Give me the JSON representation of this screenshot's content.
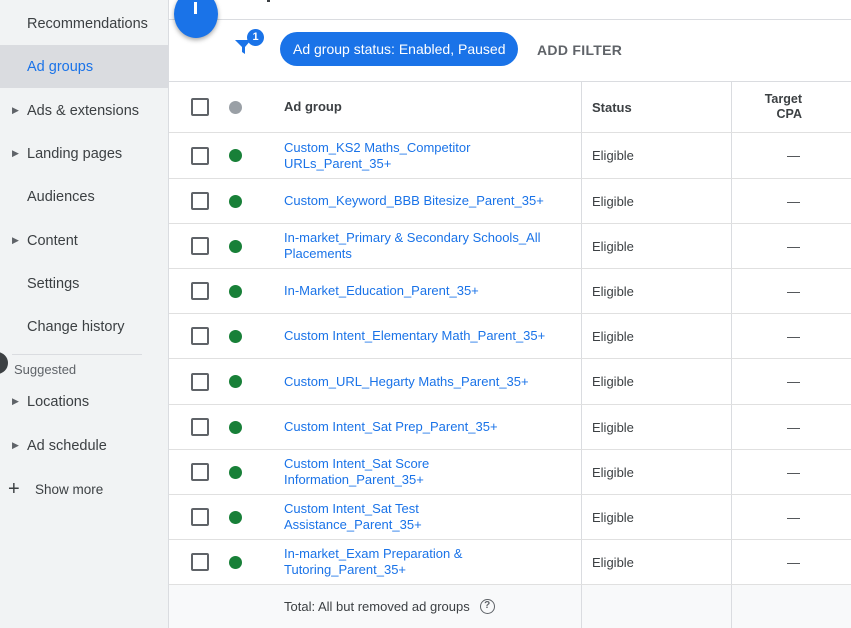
{
  "sidebar": {
    "items": [
      {
        "label": "Recommendations",
        "has_caret": false,
        "active": false
      },
      {
        "label": "Ad groups",
        "has_caret": false,
        "active": true
      },
      {
        "label": "Ads & extensions",
        "has_caret": true,
        "active": false
      },
      {
        "label": "Landing pages",
        "has_caret": true,
        "active": false
      },
      {
        "label": "Audiences",
        "has_caret": false,
        "active": false
      },
      {
        "label": "Content",
        "has_caret": true,
        "active": false
      },
      {
        "label": "Settings",
        "has_caret": false,
        "active": false
      },
      {
        "label": "Change history",
        "has_caret": false,
        "active": false
      }
    ],
    "suggested_label": "Suggested",
    "suggested_items": [
      {
        "label": "Locations",
        "has_caret": true
      },
      {
        "label": "Ad schedule",
        "has_caret": true
      }
    ],
    "show_more_label": "Show more",
    "show_more_icon": "+"
  },
  "filter_bar": {
    "filter_count": "1",
    "chip_label": "Ad group status: Enabled, Paused",
    "add_filter_label": "ADD FILTER"
  },
  "table": {
    "columns": {
      "ad_group": "Ad group",
      "status": "Status",
      "target_cpa_line1": "Target",
      "target_cpa_line2": "CPA"
    },
    "rows": [
      {
        "name_line1": "Custom_KS2 Maths_Competitor",
        "name_line2": "URLs_Parent_35+",
        "status": "Eligible",
        "target_cpa": "—"
      },
      {
        "name_line1": "Custom_Keyword_BBB Bitesize_Parent_35+",
        "name_line2": "",
        "status": "Eligible",
        "target_cpa": "—"
      },
      {
        "name_line1": "In-market_Primary & Secondary Schools_All",
        "name_line2": "Placements",
        "status": "Eligible",
        "target_cpa": "—"
      },
      {
        "name_line1": "In-Market_Education_Parent_35+",
        "name_line2": "",
        "status": "Eligible",
        "target_cpa": "—"
      },
      {
        "name_line1": "Custom Intent_Elementary Math_Parent_35+",
        "name_line2": "",
        "status": "Eligible",
        "target_cpa": "—"
      },
      {
        "name_line1": "Custom_URL_Hegarty Maths_Parent_35+",
        "name_line2": "",
        "status": "Eligible",
        "target_cpa": "—"
      },
      {
        "name_line1": "Custom Intent_Sat Prep_Parent_35+",
        "name_line2": "",
        "status": "Eligible",
        "target_cpa": "—"
      },
      {
        "name_line1": "Custom Intent_Sat Score",
        "name_line2": "Information_Parent_35+",
        "status": "Eligible",
        "target_cpa": "—"
      },
      {
        "name_line1": "Custom Intent_Sat Test",
        "name_line2": "Assistance_Parent_35+",
        "status": "Eligible",
        "target_cpa": "—"
      },
      {
        "name_line1": "In-market_Exam Preparation &",
        "name_line2": "Tutoring_Parent_35+",
        "status": "Eligible",
        "target_cpa": "—"
      }
    ],
    "footer_total": "Total: All but removed ad groups",
    "help_icon_glyph": "?"
  },
  "colors": {
    "accent": "#1a73e8",
    "status_enabled": "#188038",
    "sidebar_bg": "#f1f3f4"
  }
}
